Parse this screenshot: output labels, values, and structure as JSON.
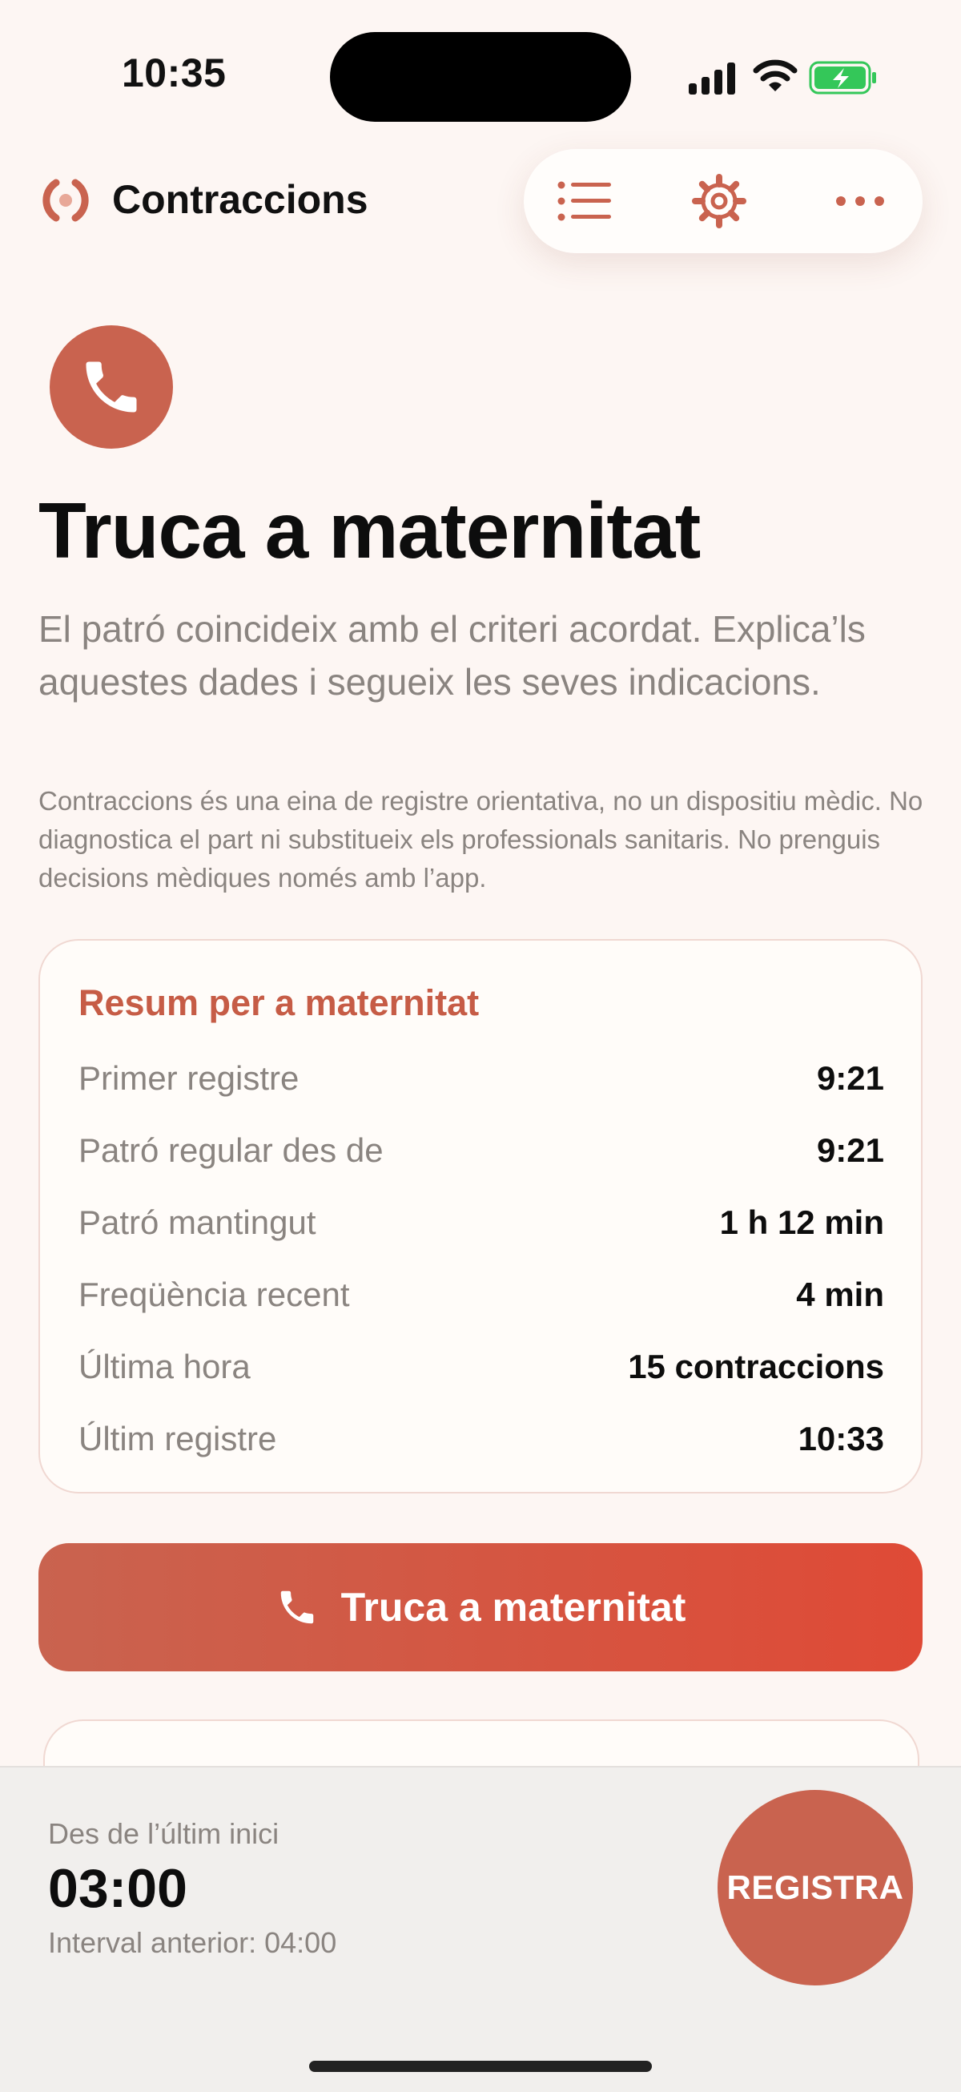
{
  "status_bar": {
    "time": "10:35"
  },
  "header": {
    "app_title": "Contraccions"
  },
  "hero": {
    "title": "Truca a maternitat",
    "subtitle": "El patró coincideix amb el criteri acordat. Explica’ls aquestes dades i segueix les seves indicacions.",
    "disclaimer": "Contraccions és una eina de registre orientativa, no un dispositiu mèdic. No diagnostica el part ni substitueix els professionals sanitaris. No prenguis decisions mèdiques només amb l’app."
  },
  "summary": {
    "title": "Resum per a maternitat",
    "rows": [
      {
        "label": "Primer registre",
        "value": "9:21"
      },
      {
        "label": "Patró regular des de",
        "value": "9:21"
      },
      {
        "label": "Patró mantingut",
        "value": "1 h 12 min"
      },
      {
        "label": "Freqüència recent",
        "value": "4 min"
      },
      {
        "label": "Última hora",
        "value": "15 contraccions"
      },
      {
        "label": "Últim registre",
        "value": "10:33"
      }
    ]
  },
  "call_button": {
    "label": "Truca a maternitat"
  },
  "bottom": {
    "since_label": "Des de l’últim inici",
    "timer": "03:00",
    "previous_interval": "Interval anterior: 04:00",
    "register_label": "REGISTRA"
  },
  "colors": {
    "accent": "#c9634f",
    "accent_bright": "#df4a36",
    "background": "#fdf6f3",
    "muted_text": "#8a8480",
    "battery_green": "#34c759"
  },
  "icons": [
    "logo-icon",
    "list-icon",
    "gear-icon",
    "more-icon",
    "phone-icon",
    "signal-icon",
    "wifi-icon",
    "battery-icon"
  ]
}
